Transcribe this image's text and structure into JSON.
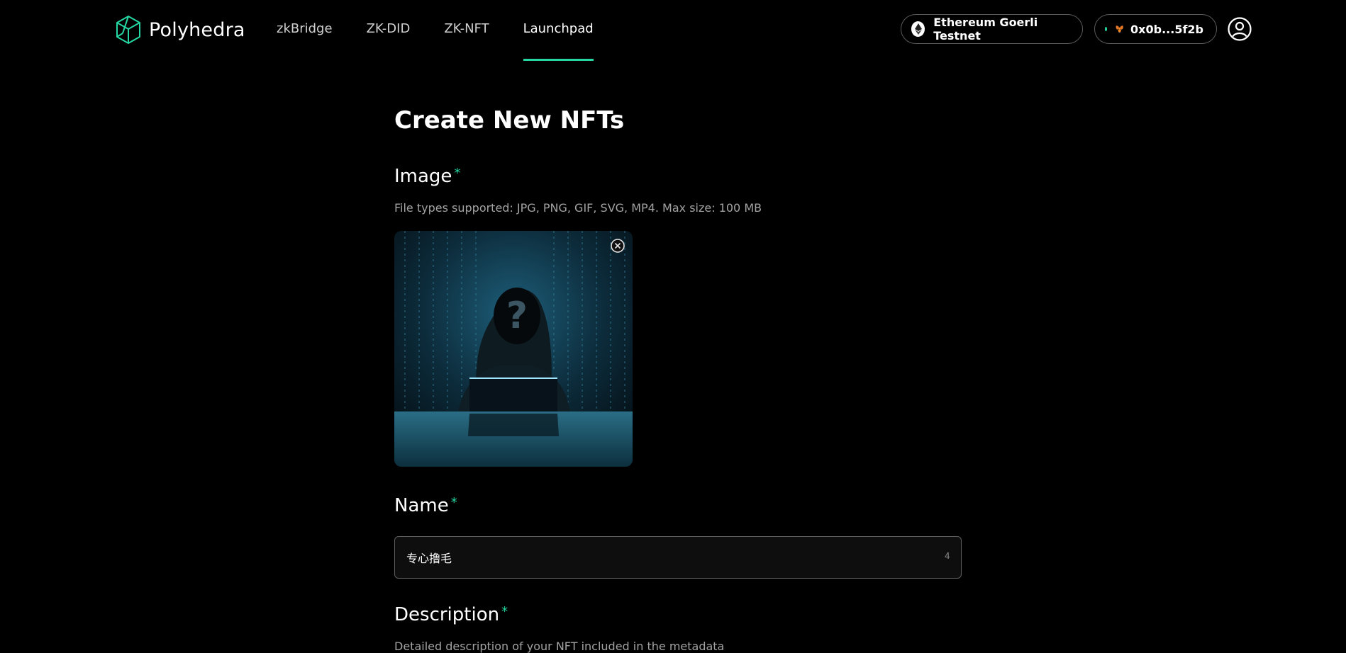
{
  "header": {
    "brand": "Polyhedra",
    "nav": [
      {
        "label": "zkBridge",
        "active": false
      },
      {
        "label": "ZK-DID",
        "active": false
      },
      {
        "label": "ZK-NFT",
        "active": false
      },
      {
        "label": "Launchpad",
        "active": true
      }
    ],
    "network_label": "Ethereum Goerli Testnet",
    "network_icon": "ethereum-icon",
    "account_label": "0x0b...5f2b",
    "account_icon": "metamask-fox-icon",
    "profile_icon": "user-circle-icon"
  },
  "main": {
    "title": "Create New NFTs",
    "image": {
      "label": "Image",
      "required_mark": "*",
      "helper": "File types supported: JPG, PNG, GIF, SVG, MP4. Max size: 100 MB",
      "preview_alt": "hooded figure with question mark face at laptop"
    },
    "name": {
      "label": "Name",
      "required_mark": "*",
      "value": "专心撸毛",
      "char_count": "4"
    },
    "description": {
      "label": "Description",
      "required_mark": "*",
      "helper": "Detailed description of your NFT included in the metadata"
    }
  },
  "colors": {
    "accent": "#25d7a2",
    "background": "#000000",
    "border": "#5a5a5a"
  }
}
